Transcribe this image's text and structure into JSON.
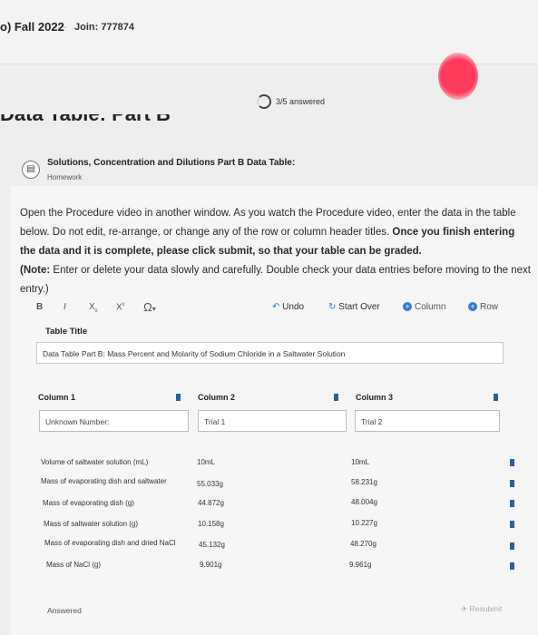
{
  "header": {
    "course": "o) Fall 2022",
    "separator": "·",
    "join": "Join: 777874"
  },
  "progress": {
    "label": "3/5 answered"
  },
  "section_title": "Data Table: Part B",
  "assignment": {
    "title": "Solutions, Concentration and Dilutions Part B Data Table:",
    "type": "Homework"
  },
  "instructions": {
    "p1_text": "Open the Procedure video in another window. As you watch the Procedure video, enter the data in the table below. Do not edit, re-arrange, or change any of the row or column header titles. ",
    "p1_bold": "Once you finish entering the data and it is complete, please click submit, so that your table can be graded.",
    "p2_bold": "(Note: ",
    "p2_text": "Enter or delete your data slowly and carefully. Double check your data entries before moving to the next entry.)"
  },
  "toolbar": {
    "bold": "B",
    "italic": "I",
    "subscript": "X",
    "superscript": "X",
    "special": "Ω",
    "undo": "Undo",
    "start_over": "Start Over",
    "column": "Column",
    "row": "Row"
  },
  "table_title_label": "Table Title",
  "table_title_value": "Data Table Part B: Mass Percent and Molarity of Sodium Chloride in a Saltwater Solution",
  "columns": [
    {
      "label": "Column 1",
      "header_value": "Unknown Number:"
    },
    {
      "label": "Column 2",
      "header_value": "Trial 1"
    },
    {
      "label": "Column 3",
      "header_value": "Trial 2"
    }
  ],
  "rows": [
    {
      "label": "Volume of saltwater solution (mL)",
      "trial1": "10mL",
      "trial2": "10mL"
    },
    {
      "label": "Mass of evaporating dish and saltwater",
      "trial1": "55.033g",
      "trial2": "58.231g"
    },
    {
      "label": "Mass of evaporating dish (g)",
      "trial1": "44.872g",
      "trial2": "48.004g"
    },
    {
      "label": "Mass of saltwater solution (g)",
      "trial1": "10.158g",
      "trial2": "10.227g"
    },
    {
      "label": "Mass of evaporating dish and dried NaCl",
      "trial1": "45.132g",
      "trial2": "48.270g"
    },
    {
      "label": "Mass of NaCl (g)",
      "trial1": "9.901g",
      "trial2": "9.961g"
    }
  ],
  "status": "Answered",
  "resubmit": "Resubmit",
  "icons": {
    "progress": "progress-ring-icon",
    "assignment": "assignment-icon",
    "undo": "undo-icon",
    "start_over": "refresh-icon",
    "add_column": "plus-circle-icon",
    "add_row": "plus-circle-icon"
  },
  "colors": {
    "accent": "#2d7fd3",
    "marker": "#2d5fa0"
  }
}
